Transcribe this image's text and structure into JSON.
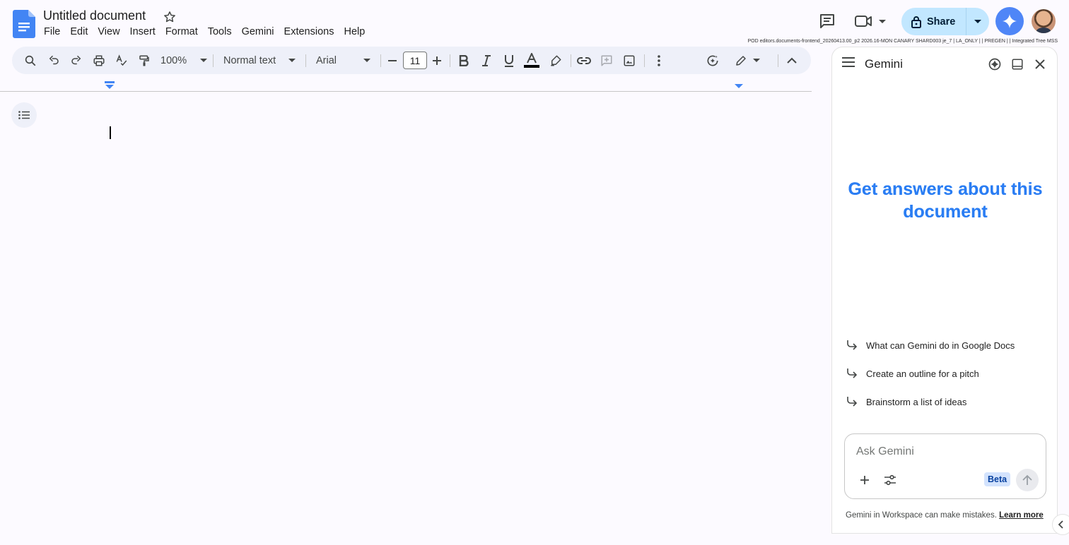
{
  "app": {
    "title": "Untitled document",
    "build_info": "POD editors.documents-frontend_20260413.00_p2 2026.16-MON CANARY SHARD003 je_7 | LA_ONLY |  | PREGEN |  | Integrated Tree   MSS"
  },
  "menu": {
    "items": [
      {
        "label": "File"
      },
      {
        "label": "Edit"
      },
      {
        "label": "View"
      },
      {
        "label": "Insert"
      },
      {
        "label": "Format"
      },
      {
        "label": "Tools"
      },
      {
        "label": "Gemini"
      },
      {
        "label": "Extensions"
      },
      {
        "label": "Help"
      }
    ]
  },
  "header": {
    "share_label": "Share"
  },
  "toolbar": {
    "zoom": "100%",
    "style": "Normal text",
    "font": "Arial",
    "font_size": "11"
  },
  "colors": {
    "accent": "#0b57d0",
    "share_bg": "#c2e7ff",
    "toolbar_bg": "#eef0f9",
    "page_bg": "#fcfaff",
    "gemini_gradient": "#217bfe"
  },
  "gemini": {
    "title": "Gemini",
    "hero": "Get answers about this document",
    "suggestions": [
      {
        "label": "What can Gemini do in Google Docs"
      },
      {
        "label": "Create an outline for a pitch"
      },
      {
        "label": "Brainstorm a list of ideas"
      }
    ],
    "input_placeholder": "Ask Gemini",
    "beta_label": "Beta",
    "disclaimer": "Gemini in Workspace can make mistakes.",
    "learn_more": "Learn more"
  },
  "icons": {
    "doc_logo": "google-docs-icon",
    "star": "star-icon",
    "comments": "comments-icon",
    "meet": "video-call-icon",
    "lock": "lock-icon",
    "gemini": "gemini-spark-icon"
  }
}
